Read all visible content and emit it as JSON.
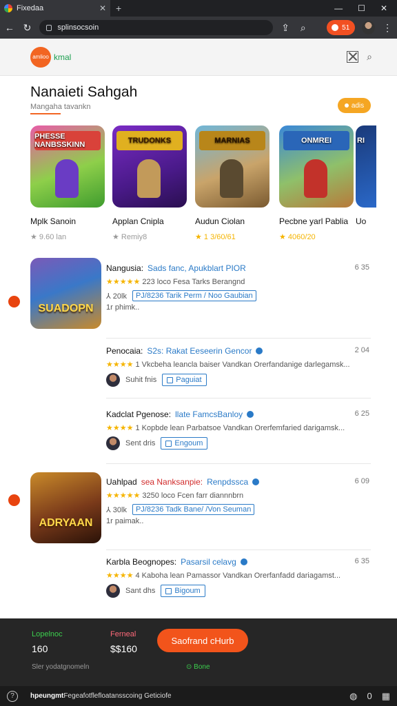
{
  "browser": {
    "tab_title": "Fixedaa",
    "url": "splinsocsoin",
    "ext_label": "51"
  },
  "site": {
    "logo_text": "amlioo",
    "brand": "kmal"
  },
  "page": {
    "title": "Nanaieti Sahgah",
    "subtitle": "Mangaha tavankn",
    "pill_label": "adis"
  },
  "featured": [
    {
      "name": "Mplk Sanoin",
      "rating": "★ 9.60 lan",
      "logo": "PHESSE NANBSSKINN",
      "star": "gray"
    },
    {
      "name": "Applan Cnipla",
      "rating": "★ Remiy8",
      "logo": "TRUDONKS",
      "star": "gray"
    },
    {
      "name": "Audun Ciolan",
      "rating": "★ 1 3/60/61",
      "logo": "MARNIAS",
      "star": "gold"
    },
    {
      "name": "Pecbne yarl Pablia",
      "rating": "★ 4060/20",
      "logo": "ONMREI",
      "star": "gold"
    },
    {
      "name": "Uo",
      "rating": "",
      "logo": "RI",
      "star": "gray"
    }
  ],
  "list": [
    {
      "name": "Nangusia:",
      "tag": "Sads fanc, Apukblart PIOR",
      "meta": "6 35",
      "line2": "★★★★★ 223 loco Fesa Tarks Berangnd",
      "line3_prefix": "⅄ 20lk",
      "line3_link": "PJ/8236 Tarik Perm / Noo Gaubian",
      "line4": "1r phimk..",
      "image_label": "SUADOPN"
    },
    {
      "name": "Penocaia:",
      "tag": "S2s: Rakat Eeseerin Gencor",
      "meta": "2 04",
      "line2": "★★★★ 1 Vkcbeha leancla baiser Vandkan Orerfandanige darlegamsk...",
      "user": "Suhit fnis",
      "button": "Paguiat"
    },
    {
      "name": "Kadclat Pgenose:",
      "tag": "llate FamcsBanloy",
      "meta": "6 25",
      "line2": "★★★★ 1 Kopbde lean Parbatsoe Vandkan Orerfemfaried darigamsk...",
      "user": "Sent dris",
      "button": "Engoum"
    },
    {
      "name": "Uahlpad",
      "tag_red": "sea Nanksanpie:",
      "tag": "Renpdssca",
      "meta": "6 09",
      "line2": "★★★★★ 3250 loco Fcen farr diannnbrn",
      "line3_prefix": "⅄ 30lk",
      "line3_link": "PJ/8236 Tadk Bane/ /Von Seuman",
      "line4": "1r paimak..",
      "image_label": "ADRYAAN"
    },
    {
      "name": "Karbla Beognopes:",
      "tag": "Pasarsil celavg",
      "meta": "6 35",
      "line2": "★★★★ 4 Kaboha lean Pamassor Vandkan Orerfanfadd dariagamst...",
      "user": "Sant dhs",
      "button": "Bigoum"
    }
  ],
  "bottom": {
    "label1": "Lopelnoc",
    "value1": "160",
    "label2": "Ferneal",
    "value2": "$$160",
    "cta": "Saofrand cHurb",
    "note": "Sler yodatgnomeln",
    "status": "⊙ Bone"
  },
  "statusbar": {
    "text_bold": "hpeungmt",
    "text": "Fegeafotflefloatansscoing Geticiofe",
    "count": "0"
  },
  "colors": {
    "accent": "#f2541b",
    "brand_green": "#1a9e4e",
    "link_blue": "#2a7ac7",
    "star_gold": "#f5b400"
  }
}
